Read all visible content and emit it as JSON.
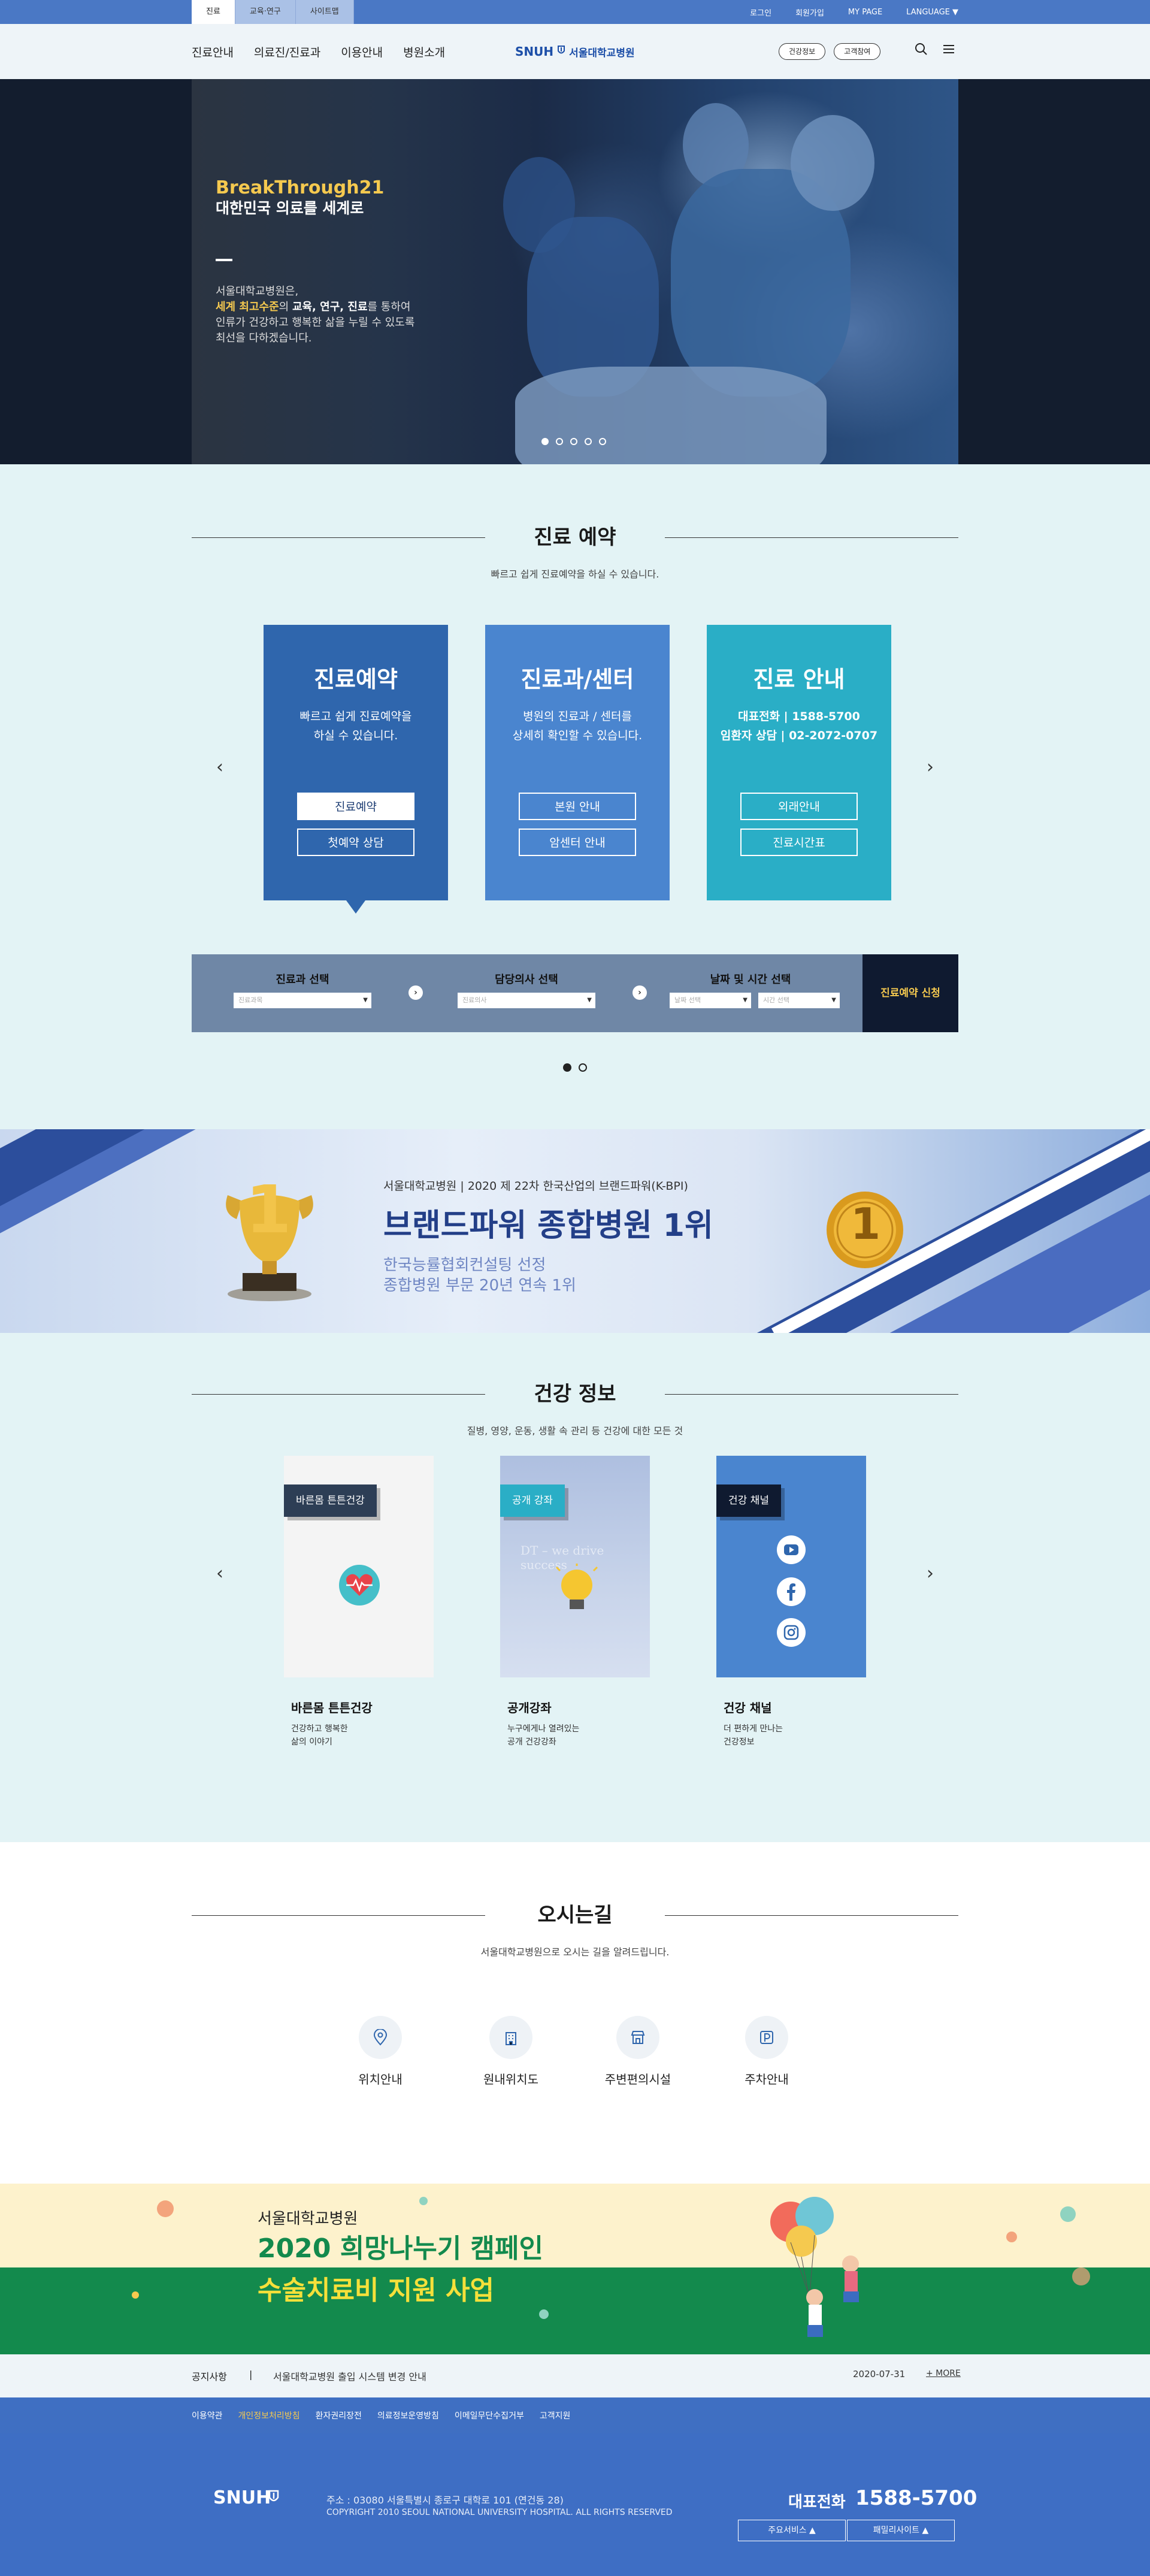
{
  "topbar": {
    "tabs": [
      "진료",
      "교육·연구",
      "사이트맵"
    ],
    "links": [
      "로그인",
      "회원가입",
      "MY PAGE",
      "LANGUAGE ▼"
    ]
  },
  "header": {
    "nav": [
      "진료안내",
      "의료진/진료과",
      "이용안내",
      "병원소개"
    ],
    "logo_en": "SNUH",
    "logo_ko": "서울대학교병원",
    "buttons": [
      "건강정보",
      "고객참여"
    ]
  },
  "hero": {
    "brand": "BreakThrough21",
    "tagline": "대한민국 의료를 세계로",
    "p1": "서울대학교병원은,",
    "p2_a": "세계 최고수준",
    "p2_b": "의 ",
    "p2_c": "교육, 연구, 진료",
    "p2_d": "를 통하여",
    "p3": "인류가 건강하고 행복한 삶을 누릴 수 있도록",
    "p4": "최선을 다하겠습니다.",
    "slide_count": 5,
    "active_slide": 1
  },
  "reservation": {
    "title": "진료 예약",
    "desc": "빠르고 쉽게 진료예약을 하실 수 있습니다.",
    "cards": [
      {
        "title": "진료예약",
        "d1": "빠르고 쉽게 진료예약을",
        "d2": "하실 수 있습니다.",
        "b1": "진료예약",
        "b2": "첫예약 상담",
        "color": "#2f66ad"
      },
      {
        "title": "진료과/센터",
        "d1": "병원의 진료과 / 센터를",
        "d2": "상세히 확인할 수 있습니다.",
        "b1": "본원 안내",
        "b2": "암센터 안내",
        "color": "#4a85cf"
      },
      {
        "title": "진료 안내",
        "d1": "대표전화 | 1588-5700",
        "d2": "임환자 상담 | 02-2072-0707",
        "b1": "외래안내",
        "b2": "진료시간표",
        "color": "#2aaec6"
      }
    ],
    "bar": {
      "col1": "진료과 선택",
      "col2": "담당의사 선택",
      "col3": "날짜 및 시간 선택",
      "sel1": "진료과목",
      "sel2": "진료의사",
      "sel3": "날짜 선택",
      "sel4": "시간 선택",
      "apply": "진료예약 신청"
    }
  },
  "banner": {
    "small": "서울대학교병원 | 2020 제 22차 한국산업의 브랜드파워(K-BPI)",
    "big": "브랜드파워 종합병원 1위",
    "sub1": "한국능률협회컨설팅 선정",
    "sub2": "종합병원 부문 20년 연속 1위",
    "trophy": "1",
    "medal": "1"
  },
  "health": {
    "title": "건강 정보",
    "desc": "질병, 영양, 운동, 생활 속 관리 등 건강에 대한 모든 것",
    "cards": [
      {
        "tag": "바른몸 튼튼건강",
        "title": "바른몸 튼튼건강",
        "d1": "건강하고 행복한",
        "d2": "삶의 이야기"
      },
      {
        "tag": "공개 강좌",
        "title": "공개강좌",
        "d1": "누구에게나 열려있는",
        "d2": "공개 건강강좌"
      },
      {
        "tag": "건강 채널",
        "title": "건강 채널",
        "d1": "더 편하게 만나는",
        "d2": "건강정보"
      }
    ],
    "lecture_bg_text": "DT – we drive success"
  },
  "directions": {
    "title": "오시는길",
    "desc": "서울대학교병원으로 오시는 길을 알려드립니다.",
    "items": [
      "위치안내",
      "원내위치도",
      "주변편의시설",
      "주차안내"
    ]
  },
  "campaign": {
    "line1": "서울대학교병원",
    "line2": "2020 희망나누기 캠페인",
    "line3": "수술치료비 지원 사업"
  },
  "notice": {
    "label": "공지사항",
    "sep": "|",
    "text": "서울대학교병원 출입 시스템 변경 안내",
    "date": "2020-07-31",
    "more": "+ MORE"
  },
  "footer": {
    "links": [
      "이용약관",
      "개인정보처리방침",
      "환자권리장전",
      "의료정보운영방침",
      "이메일무단수집거부",
      "고객지원"
    ],
    "logo": "SNUH",
    "address": "주소 : 03080 서울특별시 종로구 대학로 101 (연건동 28)",
    "copyright": "COPYRIGHT 2010 SEOUL NATIONAL UNIVERSITY HOSPITAL. ALL RIGHTS RESERVED",
    "tel_label": "대표전화",
    "tel": "1588-5700",
    "sel1": "주요서비스 ▲",
    "sel2": "패밀리사이트 ▲"
  }
}
